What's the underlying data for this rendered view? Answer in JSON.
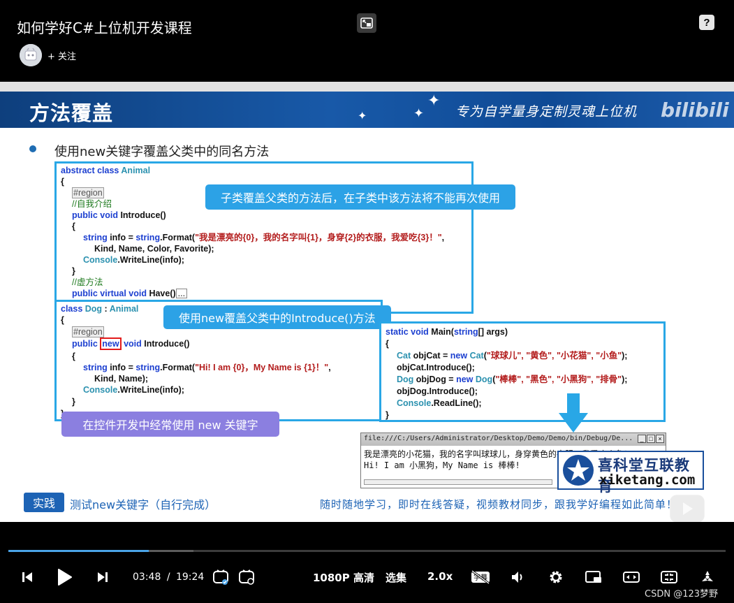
{
  "header": {
    "title": "如何学好C#上位机开发课程",
    "follow_label": "+ 关注"
  },
  "slide": {
    "banner_title": "方法覆盖",
    "slogan": "专为自学量身定制灵魂上位机",
    "brand": "bilibili",
    "bullet": "使用new关键字覆盖父类中的同名方法",
    "callout_top": "子类覆盖父类的方法后，在子类中该方法将不能再次使用",
    "callout_middle": "使用new覆盖父类中的Introduce()方法",
    "callout_bottom": "在控件开发中经常使用 new 关键字",
    "animal_code": {
      "l1_kw": "abstract class ",
      "l1_ty": "Animal",
      "l2": "{",
      "l3": "#region",
      "l4": "//自我介绍",
      "l5_kw": "public void ",
      "l5": "Introduce()",
      "l6": "{",
      "l7_kw1": "string ",
      "l7_a": "info = ",
      "l7_kw2": "string",
      "l7_b": ".Format(",
      "l7_st": "\"我是漂亮的{0}，我的名字叫{1}，身穿{2}的衣服，我爱吃{3}！\"",
      "l7_c": ",",
      "l8": "Kind, Name, Color, Favorite);",
      "l9_ty": "Console",
      "l9": ".WriteLine(info);",
      "l10": "}",
      "l11": "//虚方法",
      "l12_kw": "public virtual void ",
      "l12": "Have()",
      "l12_dots": "..."
    },
    "dog_code": {
      "l1_kw": "class ",
      "l1_ty": "Dog",
      "l1_a": " : ",
      "l1_ty2": "Animal",
      "l2": "{",
      "l3": "#region",
      "l4_kw1": "public ",
      "l4_new": "new",
      "l4_kw2": " void ",
      "l4": "Introduce()",
      "l5": "{",
      "l6_kw1": "string ",
      "l6_a": "info = ",
      "l6_kw2": "string",
      "l6_b": ".Format(",
      "l6_st": "\"Hi! I am {0}，My Name is {1}！\"",
      "l6_c": ",",
      "l7": "Kind, Name);",
      "l8_ty": "Console",
      "l8": ".WriteLine(info);",
      "l9": "}",
      "l10": "}"
    },
    "main_code": {
      "l1_kw": "static void ",
      "l1": "Main(",
      "l1_kw2": "string",
      "l1_b": "[] args)",
      "l2": "{",
      "l3_ty": "Cat ",
      "l3_a": "objCat = ",
      "l3_kw": "new ",
      "l3_ty2": "Cat",
      "l3_b": "(",
      "l3_st": "\"球球儿\", \"黄色\", \"小花猫\", \"小鱼\"",
      "l3_c": ");",
      "l4": "objCat.Introduce();",
      "l5_ty": "Dog ",
      "l5_a": "objDog = ",
      "l5_kw": "new ",
      "l5_ty2": "Dog",
      "l5_b": "(",
      "l5_st": "\"棒棒\", \"黑色\", \"小黑狗\", \"排骨\"",
      "l5_c": ");",
      "l6": "objDog.Introduce();",
      "l7_ty": "Console",
      "l7": ".ReadLine();",
      "l8": "}"
    },
    "console_window": {
      "path": "file:///C:/Users/Administrator/Desktop/Demo/Demo/bin/Debug/De...",
      "line1": "我是漂亮的小花猫，我的名字叫球球儿，身穿黄色的衣服，我爱吃小鱼！",
      "line2": "Hi! I am 小黑狗，My Name is 棒棒!"
    },
    "logo_cn": "喜科堂互联教育",
    "logo_en": "xiketang.com",
    "practice_badge": "实践",
    "practice_text": "测试new关键字（自行完成）",
    "footer_text": "随时随地学习，即时在线答疑，视频教材同步，跟我学好编程如此简单！"
  },
  "controls": {
    "current_time": "03:48",
    "separator": "/",
    "total_time": "19:24",
    "progress_fraction": 0.196,
    "buffer_fraction": 0.258,
    "quality": "1080P 高清",
    "episodes": "选集",
    "speed": "2.0x",
    "subtitle_icon_text": "字幕",
    "danmaku_icon_text": "弹"
  },
  "watermark": "CSDN @123梦野",
  "colors": {
    "accent": "#4aa3e6",
    "banner": "#1859a8",
    "callout_blue": "#2ca2e6",
    "callout_purple": "#8b7fe0",
    "code_border": "#29a7e6"
  }
}
